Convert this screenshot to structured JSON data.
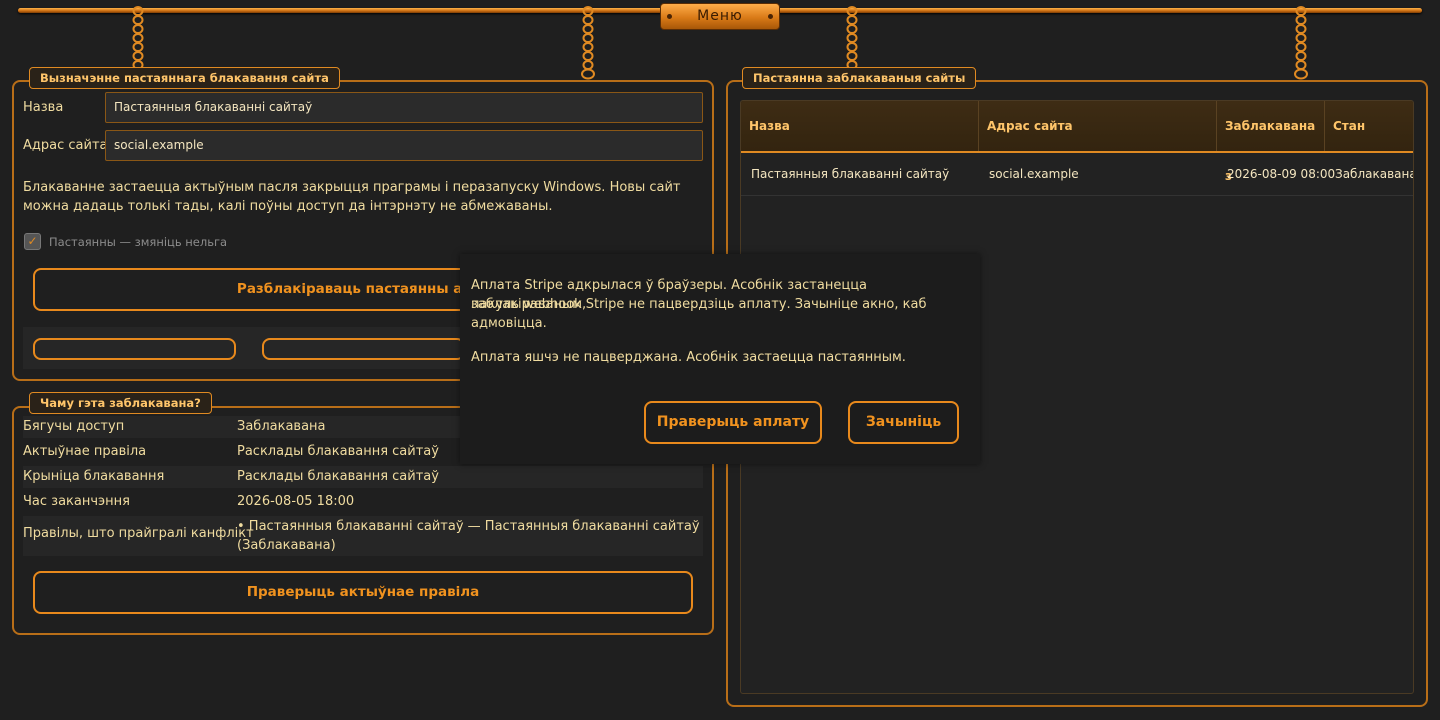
{
  "menu": {
    "label": "Меню"
  },
  "definition": {
    "legend": "Вызначэнне пастаяннага блакавання сайта",
    "name_label": "Назва",
    "name_value": "Пастаянныя блакаванні сайтаў",
    "url_label": "Адрас сайта",
    "url_value": "social.example",
    "note": "Блакаванне застаецца актыўным пасля закрыцця праграмы і перазапуску Windows. Новы сайт можна дадаць толькі тады, калі поўны доступ да інтэрнэту не абмежаваны.",
    "permanent_label": "Пастаянны — змяніць нельга",
    "permanent_checked": true,
    "unlock_button": "Разблакіраваць пастаянны асоб"
  },
  "why": {
    "legend": "Чаму гэта заблакавана?",
    "rows": [
      {
        "label": "Бягучы доступ",
        "value": "Заблакавана"
      },
      {
        "label": "Актыўнае правіла",
        "value": "Расклады блакавання сайтаў"
      },
      {
        "label": "Крыніца блакавання",
        "value": "Расклады блакавання сайтаў"
      },
      {
        "label": "Час заканчэння",
        "value": "2026-08-05 18:00"
      }
    ],
    "conflict_label": "Правілы, што прайгралі канфлікт",
    "conflict_value_1": "• Пастаянныя блакаванні сайтаў — Пастаянныя блакаванні сайтаў",
    "conflict_value_2": "(Заблакавана)",
    "check_button": "Праверыць актыўнае правіла"
  },
  "blocked": {
    "legend": "Пастаянна заблакаваныя сайты",
    "columns": [
      "Назва",
      "Адрас сайта",
      "Заблакавана з",
      "Стан"
    ],
    "rows": [
      {
        "name": "Пастаянныя блакаванні сайтаў",
        "url": "social.example",
        "since": "2026-08-09 08:00",
        "status": "Заблакавана"
      }
    ]
  },
  "dialog": {
    "line1": "Аплата Stripe адкрылася ў браўзеры. Асобнік застанецца заблакіраваным,",
    "line2": "пакуль webhook Stripe не пацвердзіць аплату. Зачыніце акно, каб адмовіцца.",
    "status": "Аплата яшчэ не пацверджана. Асобнік застаецца пастаянным.",
    "verify_button": "Праверыць аплату",
    "close_button": "Зачыніць"
  },
  "colors": {
    "accent": "#e8891c",
    "text": "#f0dca0",
    "background": "#1f1f1f"
  }
}
